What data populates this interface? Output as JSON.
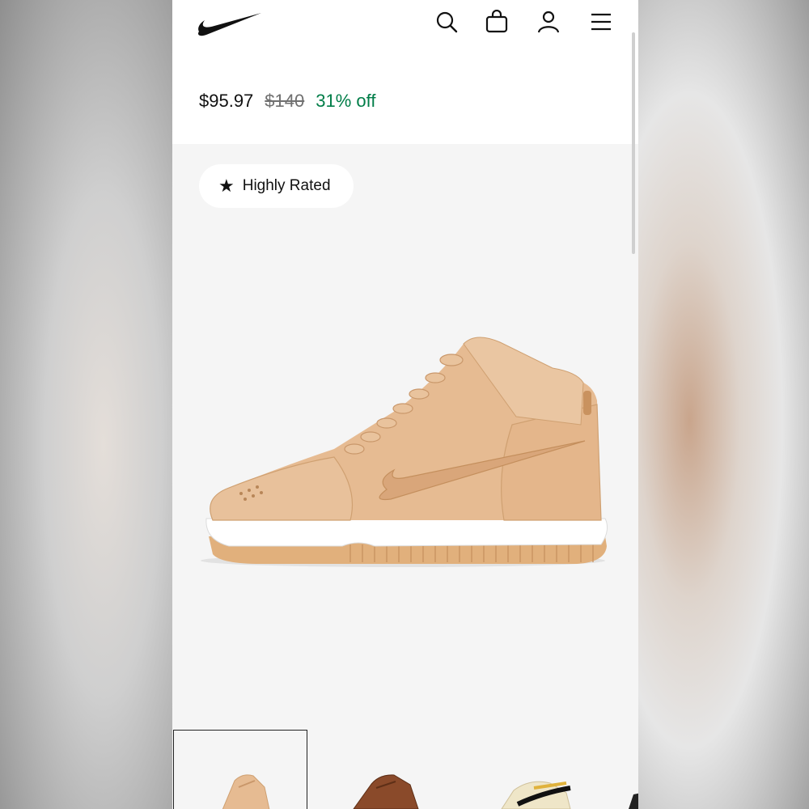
{
  "header": {
    "logo": "nike-swoosh-icon",
    "icons": [
      "search-icon",
      "bag-icon",
      "user-icon",
      "menu-icon"
    ]
  },
  "price": {
    "current": "$95.97",
    "original": "$140",
    "discount": "31% off"
  },
  "badge": {
    "star": "★",
    "label": "Highly Rated"
  },
  "colors": {
    "discount_green": "#007d48",
    "shoe_tan": "#e3b48a",
    "background_gray": "#f5f5f5"
  },
  "thumbnails": [
    {
      "color": "tan",
      "selected": true
    },
    {
      "color": "brown",
      "selected": false
    },
    {
      "color": "cream-black",
      "selected": false
    }
  ]
}
